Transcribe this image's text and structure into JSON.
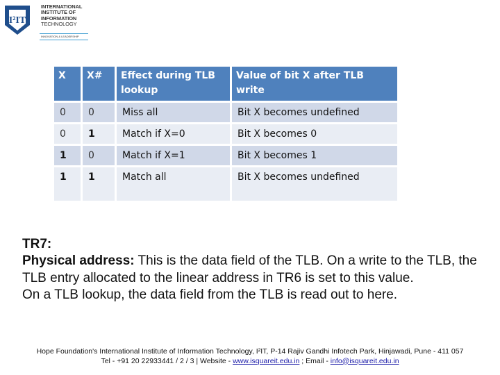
{
  "logo": {
    "mark_text": "I²IT",
    "name_lines": [
      "INTERNATIONAL",
      "INSTITUTE OF",
      "INFORMATION",
      "TECHNOLOGY"
    ],
    "tagline": "INNOVATION & LEADERSHIP",
    "brand_color": "#1f4e8c",
    "accent_color": "#3a9bd0"
  },
  "table": {
    "header_color": "#4f81bd",
    "row_color_odd": "#d0d8e8",
    "row_color_even": "#e9edf4",
    "headers": [
      "X",
      "X#",
      "Effect during TLB lookup",
      "Value of bit X after TLB write"
    ],
    "rows": [
      [
        "0",
        "0",
        "Miss all",
        "Bit X becomes undefined"
      ],
      [
        "0",
        "1",
        "Match if X=0",
        "Bit X becomes 0"
      ],
      [
        "1",
        "0",
        "Match if X=1",
        "Bit X becomes 1"
      ],
      [
        "1",
        "1",
        "Match all",
        "Bit X becomes undefined"
      ]
    ]
  },
  "content": {
    "heading": "TR7:",
    "term": "Physical address:",
    "paragraph1": " This is the data field of the TLB. On a write to the TLB, the TLB entry allocated to the linear address in TR6 is set to this value.",
    "paragraph2": "On a TLB lookup, the data field from the TLB is read out to here."
  },
  "footer": {
    "line1": "Hope Foundation's International Institute of Information Technology, I²IT, P-14 Rajiv Gandhi Infotech Park, Hinjawadi, Pune - 411 057",
    "tel": "Tel - +91 20 22933441 / 2 / 3  |  Website - ",
    "website": "www.isquareit.edu.in",
    "email_label": " ; Email - ",
    "email": "info@isquareit.edu.in"
  }
}
